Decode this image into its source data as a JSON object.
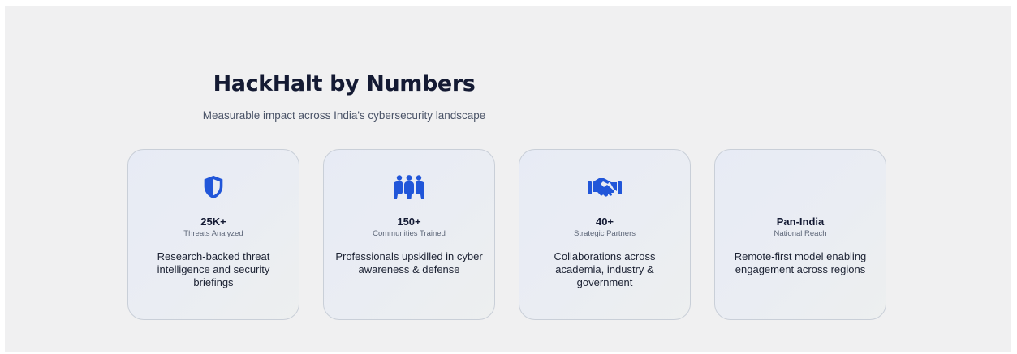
{
  "section": {
    "title": "HackHalt by Numbers",
    "subtitle": "Measurable impact across India's cybersecurity landscape"
  },
  "theme": {
    "icon_color": "#2156d9",
    "title_color": "#141a33"
  },
  "stats": [
    {
      "icon": "shield-icon",
      "value": "25K+",
      "label": "Threats Analyzed",
      "description": "Research-backed threat intelligence and security briefings"
    },
    {
      "icon": "people-group-icon",
      "value": "150+",
      "label": "Communities Trained",
      "description": "Professionals upskilled in cyber awareness & defense"
    },
    {
      "icon": "handshake-icon",
      "value": "40+",
      "label": "Strategic Partners",
      "description": "Collaborations across academia, industry & government"
    },
    {
      "icon": "",
      "value": "Pan-India",
      "label": "National Reach",
      "description": "Remote-first model enabling engagement across regions"
    }
  ]
}
